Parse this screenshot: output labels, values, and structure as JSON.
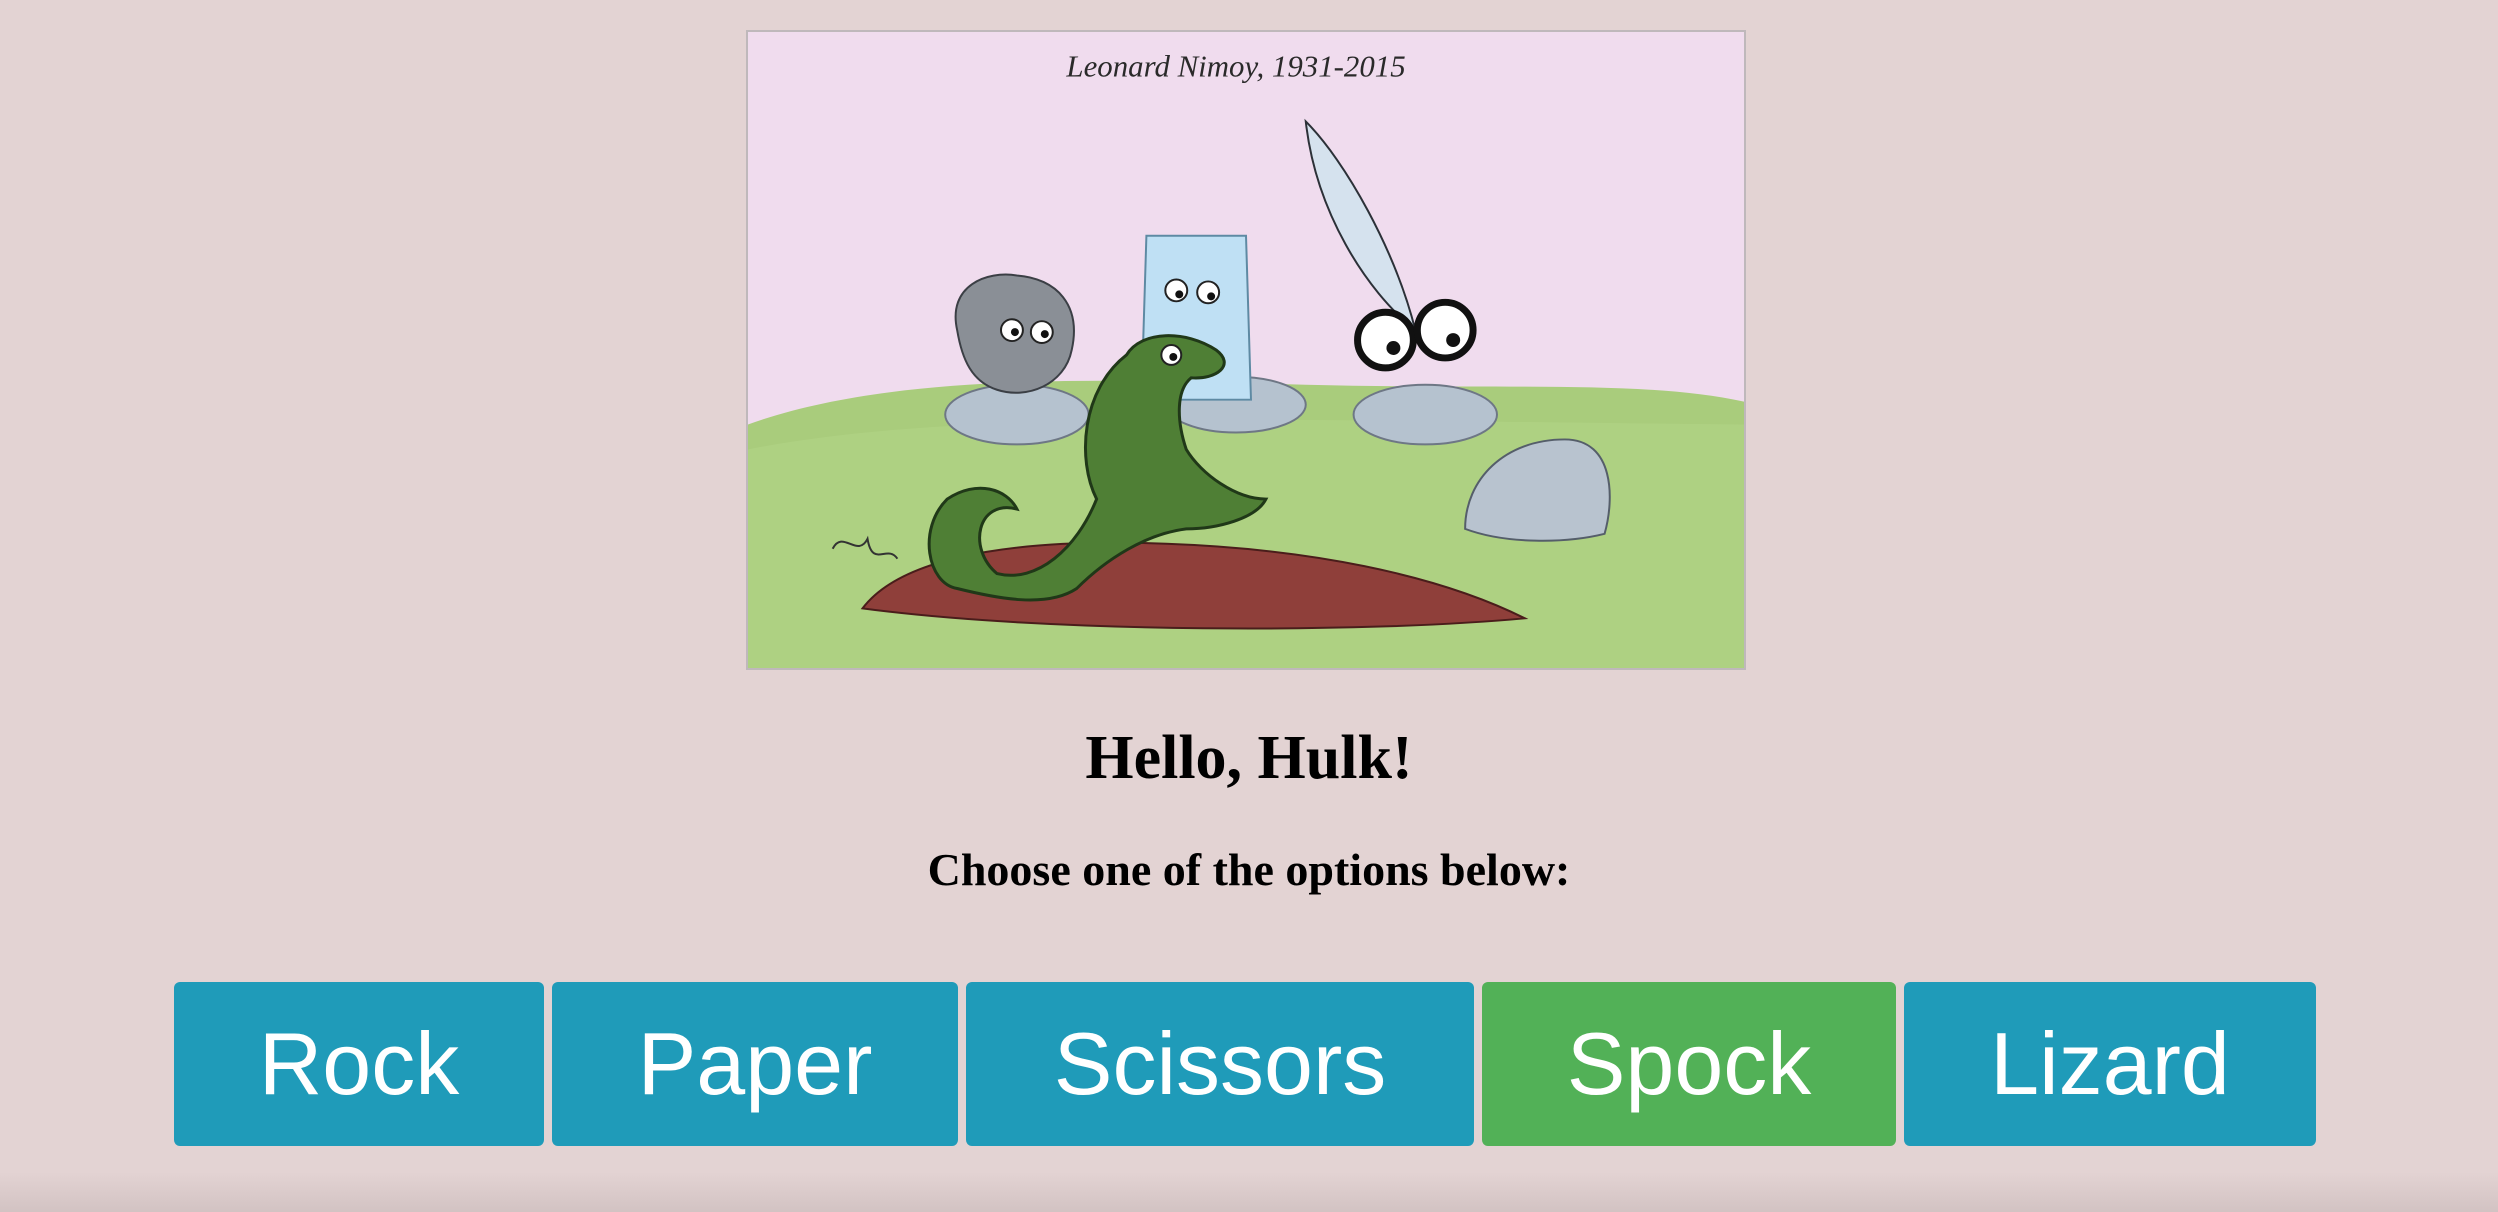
{
  "illustration": {
    "caption": "Leonard Nimoy, 1931-2015",
    "description_icon": "rock-paper-scissors-lizard-spock-cartoon"
  },
  "greeting": "Hello, Hulk!",
  "prompt": "Choose one of the options below:",
  "options": [
    {
      "label": "Rock",
      "selected": false
    },
    {
      "label": "Paper",
      "selected": false
    },
    {
      "label": "Scissors",
      "selected": false
    },
    {
      "label": "Spock",
      "selected": true
    },
    {
      "label": "Lizard",
      "selected": false
    }
  ],
  "colors": {
    "background": "#e3d3d3",
    "button": "#1f9bb9",
    "button_selected": "#52b157",
    "button_text": "#ffffff"
  }
}
